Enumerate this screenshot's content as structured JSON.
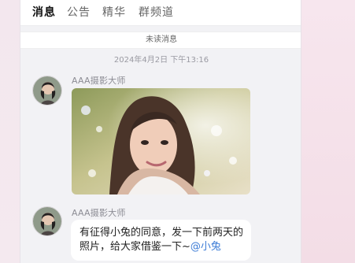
{
  "tabs": [
    {
      "label": "消息",
      "active": true
    },
    {
      "label": "公告",
      "active": false
    },
    {
      "label": "精华",
      "active": false
    },
    {
      "label": "群频道",
      "active": false
    }
  ],
  "unread_banner": "未读消息",
  "timestamp": "2024年4月2日 下午13:16",
  "messages": [
    {
      "sender": "AAA摄影大师",
      "type": "image",
      "avatar_icon": "user-avatar-icon"
    },
    {
      "sender": "AAA摄影大师",
      "type": "text",
      "text": "有征得小兔的同意，发一下前两天的照片，给大家借鉴一下~",
      "mention": "@小兔",
      "avatar_icon": "user-avatar-icon"
    }
  ],
  "colors": {
    "panel_bg": "#f2f2f5",
    "bubble_bg": "#ffffff",
    "mention": "#3d7cd6",
    "active_tab": "#111111",
    "inactive_tab": "#666666"
  }
}
